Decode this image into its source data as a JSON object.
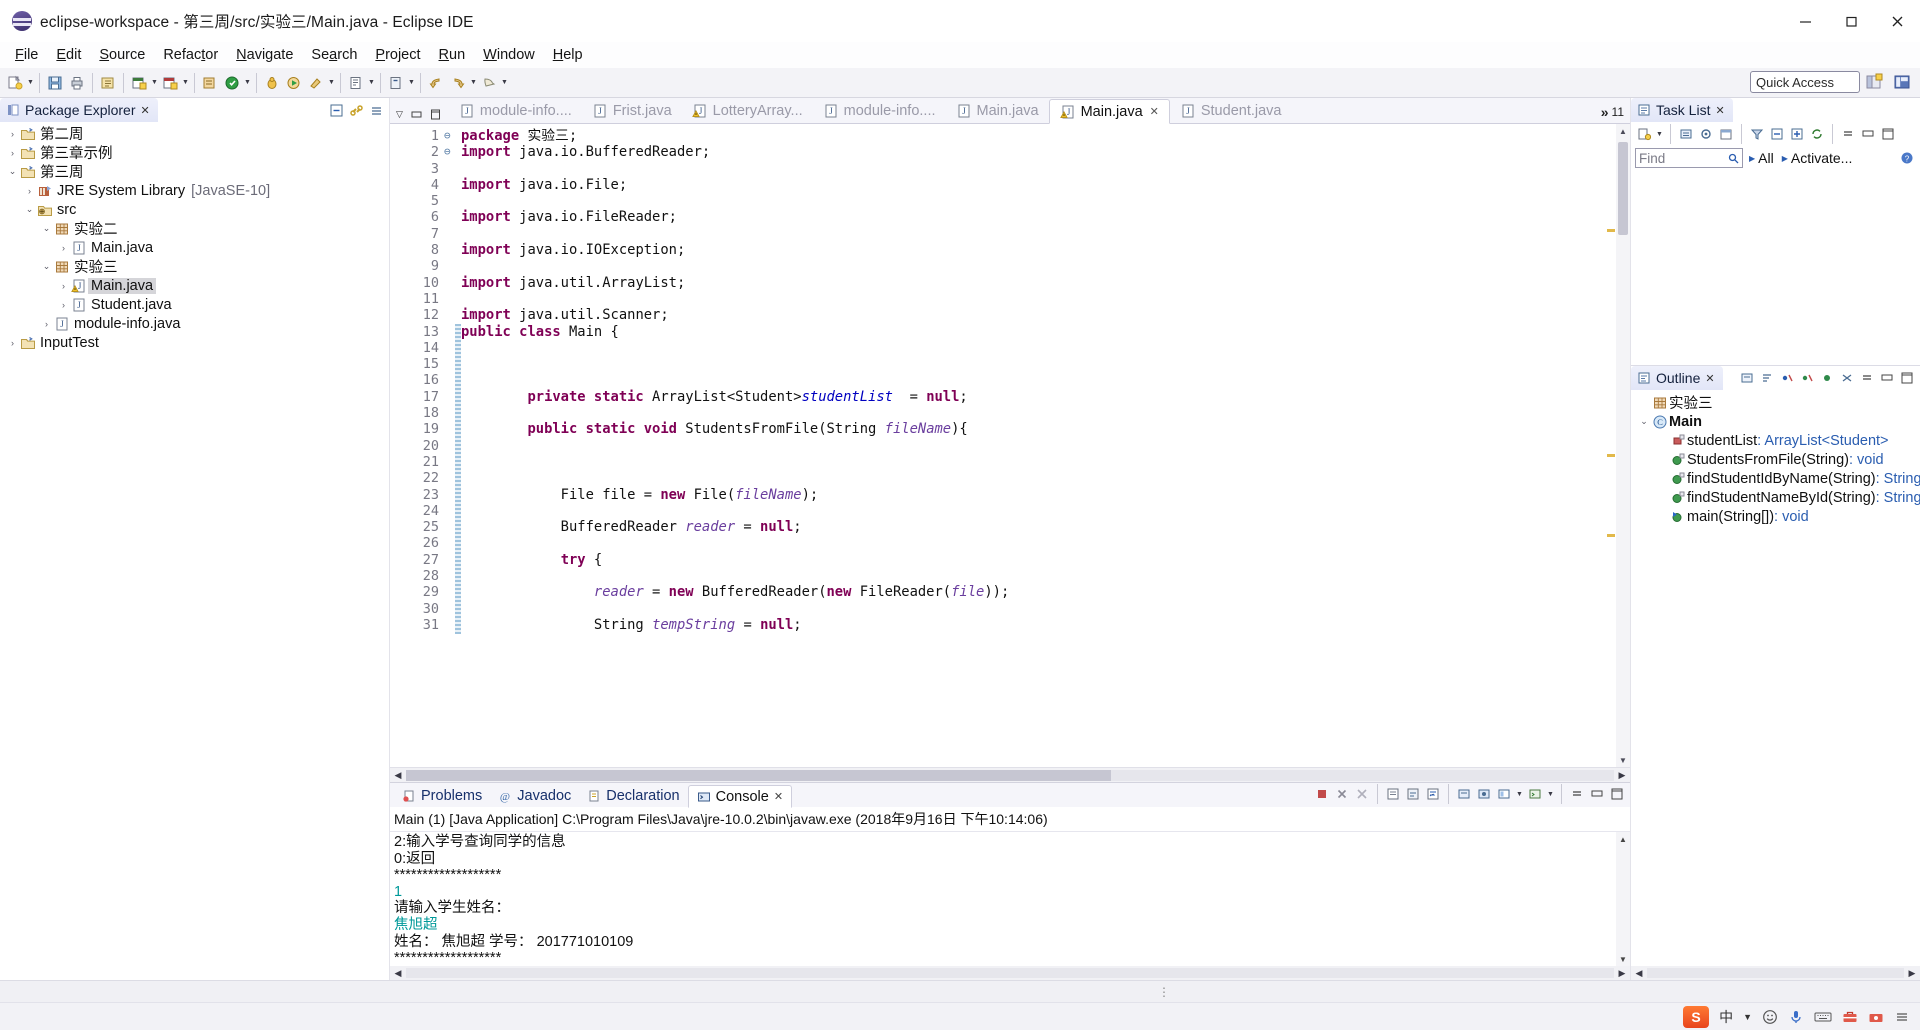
{
  "window": {
    "title": "eclipse-workspace - 第三周/src/实验三/Main.java - Eclipse IDE",
    "app_icon": "eclipse-icon",
    "minimize": "–",
    "maximize": "▢",
    "close": "✕"
  },
  "menu": [
    {
      "label": "File",
      "mnemonic": "F"
    },
    {
      "label": "Edit",
      "mnemonic": "E"
    },
    {
      "label": "Source",
      "mnemonic": "S"
    },
    {
      "label": "Refactor",
      "mnemonic": "t"
    },
    {
      "label": "Navigate",
      "mnemonic": "N"
    },
    {
      "label": "Search",
      "mnemonic": "a"
    },
    {
      "label": "Project",
      "mnemonic": "P"
    },
    {
      "label": "Run",
      "mnemonic": "R"
    },
    {
      "label": "Window",
      "mnemonic": "W"
    },
    {
      "label": "Help",
      "mnemonic": "H"
    }
  ],
  "toolbar": {
    "quick_access": "Quick Access",
    "buttons": [
      "new-wizard-icon",
      "save-icon",
      "print-icon",
      "build-all-icon",
      "new-java-project-icon",
      "new-package-icon",
      "new-class-icon",
      "debug-icon",
      "run-icon",
      "run-external-tools-icon",
      "coverage-icon",
      "new-java-element-icon",
      "open-type-icon",
      "search-icon",
      "next-annotation-icon",
      "previous-annotation-icon",
      "last-edit-location-icon",
      "back-icon",
      "forward-icon",
      "pin-editor-icon"
    ],
    "perspectives": [
      "open-perspective-icon",
      "java-perspective-icon"
    ]
  },
  "package_explorer": {
    "title": "Package Explorer",
    "close_glyph": "✕",
    "tools": [
      "collapse-all-icon",
      "link-with-editor-icon",
      "view-menu-icon"
    ],
    "tree": [
      {
        "indent": 0,
        "arrow": "collapsed",
        "icon": "java-project-icon",
        "label": "第二周",
        "selected": false,
        "dim": ""
      },
      {
        "indent": 0,
        "arrow": "collapsed",
        "icon": "java-project-icon",
        "label": "第三章示例",
        "selected": false,
        "dim": ""
      },
      {
        "indent": 0,
        "arrow": "expanded",
        "icon": "java-project-icon",
        "label": "第三周",
        "selected": false,
        "dim": ""
      },
      {
        "indent": 1,
        "arrow": "collapsed",
        "icon": "jre-library-icon",
        "label": "JRE System Library",
        "selected": false,
        "dim": "[JavaSE-10]"
      },
      {
        "indent": 1,
        "arrow": "expanded",
        "icon": "source-folder-icon",
        "label": "src",
        "selected": false,
        "dim": ""
      },
      {
        "indent": 2,
        "arrow": "expanded",
        "icon": "package-icon",
        "label": "实验二",
        "selected": false,
        "dim": ""
      },
      {
        "indent": 3,
        "arrow": "collapsed",
        "icon": "java-file-icon",
        "label": "Main.java",
        "selected": false,
        "dim": ""
      },
      {
        "indent": 2,
        "arrow": "expanded",
        "icon": "package-icon",
        "label": "实验三",
        "selected": false,
        "dim": ""
      },
      {
        "indent": 3,
        "arrow": "collapsed",
        "icon": "java-file-warning-icon",
        "label": "Main.java",
        "selected": true,
        "dim": ""
      },
      {
        "indent": 3,
        "arrow": "collapsed",
        "icon": "java-file-icon",
        "label": "Student.java",
        "selected": false,
        "dim": ""
      },
      {
        "indent": 2,
        "arrow": "collapsed",
        "icon": "java-file-icon",
        "label": "module-info.java",
        "selected": false,
        "dim": ""
      },
      {
        "indent": 0,
        "arrow": "collapsed",
        "icon": "java-project-icon",
        "label": "InputTest",
        "selected": false,
        "dim": ""
      }
    ]
  },
  "editor": {
    "tabs": [
      {
        "label": "module-info....",
        "icon": "java-file-icon",
        "active": false
      },
      {
        "label": "Frist.java",
        "icon": "java-file-icon",
        "active": false
      },
      {
        "label": "LotteryArray...",
        "icon": "java-file-warning-icon",
        "active": false
      },
      {
        "label": "module-info....",
        "icon": "java-file-icon",
        "active": false
      },
      {
        "label": "Main.java",
        "icon": "java-file-icon",
        "active": false
      },
      {
        "label": "Main.java",
        "icon": "java-file-warning-icon",
        "active": true
      },
      {
        "label": "Student.java",
        "icon": "java-file-icon",
        "active": false
      }
    ],
    "active_tab_close": "✕",
    "overflow_chevron": "»",
    "overflow_count": "11",
    "view_menu": "▽",
    "minimize": "▭",
    "maximize": "▤",
    "lines": [
      {
        "n": "1",
        "fold": "",
        "html": "<span class=\"kw\">package</span> 实验三;"
      },
      {
        "n": "2",
        "fold": "⊖",
        "html": "<span class=\"kw\">import</span> java.io.BufferedReader;"
      },
      {
        "n": "3",
        "fold": "",
        "html": ""
      },
      {
        "n": "4",
        "fold": "",
        "html": "<span class=\"kw\">import</span> java.io.File;"
      },
      {
        "n": "5",
        "fold": "",
        "html": ""
      },
      {
        "n": "6",
        "fold": "",
        "html": "<span class=\"kw\">import</span> java.io.FileReader;"
      },
      {
        "n": "7",
        "fold": "",
        "html": ""
      },
      {
        "n": "8",
        "fold": "",
        "html": "<span class=\"kw\">import</span> java.io.IOException;"
      },
      {
        "n": "9",
        "fold": "",
        "html": ""
      },
      {
        "n": "10",
        "fold": "",
        "html": "<span class=\"kw\">import</span> java.util.ArrayList;"
      },
      {
        "n": "11",
        "fold": "",
        "html": ""
      },
      {
        "n": "12",
        "fold": "",
        "html": "<span class=\"kw\">import</span> java.util.Scanner;"
      },
      {
        "n": "13",
        "fold": "",
        "html": "<span class=\"kw\">public class</span> Main {"
      },
      {
        "n": "14",
        "fold": "",
        "html": ""
      },
      {
        "n": "15",
        "fold": "",
        "html": ""
      },
      {
        "n": "16",
        "fold": "",
        "html": ""
      },
      {
        "n": "17",
        "fold": "",
        "html": "        <span class=\"kw\">private static</span> ArrayList&lt;Student&gt;<span class=\"fld\">studentList</span>  = <span class=\"kw\">null</span>;"
      },
      {
        "n": "18",
        "fold": "",
        "html": ""
      },
      {
        "n": "19",
        "fold": "⊖",
        "html": "        <span class=\"kw\">public static void</span> StudentsFromFile(String <span class=\"param\">fileName</span>){"
      },
      {
        "n": "20",
        "fold": "",
        "html": ""
      },
      {
        "n": "21",
        "fold": "",
        "html": ""
      },
      {
        "n": "22",
        "fold": "",
        "html": ""
      },
      {
        "n": "23",
        "fold": "",
        "html": "            File file = <span class=\"kw\">new</span> File(<span class=\"param\">fileName</span>);"
      },
      {
        "n": "24",
        "fold": "",
        "html": ""
      },
      {
        "n": "25",
        "fold": "",
        "html": "            BufferedReader <span class=\"param\">reader</span> = <span class=\"kw\">null</span>;"
      },
      {
        "n": "26",
        "fold": "",
        "html": ""
      },
      {
        "n": "27",
        "fold": "",
        "html": "            <span class=\"kw\">try</span> {"
      },
      {
        "n": "28",
        "fold": "",
        "html": ""
      },
      {
        "n": "29",
        "fold": "",
        "html": "                <span class=\"param\">reader</span> = <span class=\"kw\">new</span> BufferedReader(<span class=\"kw\">new</span> FileReader(<span class=\"param\">file</span>));"
      },
      {
        "n": "30",
        "fold": "",
        "html": ""
      },
      {
        "n": "31",
        "fold": "",
        "html": "                String <span class=\"param\">tempString</span> = <span class=\"kw\">null</span>;"
      }
    ]
  },
  "bottom_panel": {
    "tabs": [
      {
        "label": "Problems",
        "icon": "problems-icon",
        "active": false
      },
      {
        "label": "Javadoc",
        "icon": "javadoc-icon",
        "active": false
      },
      {
        "label": "Declaration",
        "icon": "declaration-icon",
        "active": false
      },
      {
        "label": "Console",
        "icon": "console-icon",
        "active": true
      }
    ],
    "close_glyph": "✕",
    "launch_info": "Main (1) [Java Application] C:\\Program Files\\Java\\jre-10.0.2\\bin\\javaw.exe (2018年9月16日 下午10:14:06)",
    "tools": [
      "terminate-icon",
      "remove-launch-icon",
      "remove-all-terminated-icon",
      "clear-console-icon",
      "scroll-lock-icon",
      "word-wrap-icon",
      "show-console-on-output-icon",
      "pin-console-icon",
      "display-selected-console-icon",
      "open-console-icon",
      "view-menu-icon",
      "minimize-icon",
      "maximize-icon"
    ],
    "output": [
      {
        "text": "2:输入学号查询同学的信息",
        "kind": "out"
      },
      {
        "text": "0:返回",
        "kind": "out"
      },
      {
        "text": "*******************",
        "kind": "out"
      },
      {
        "text": "1",
        "kind": "in"
      },
      {
        "text": "请输入学生姓名：",
        "kind": "out"
      },
      {
        "text": "焦旭超",
        "kind": "in"
      },
      {
        "text": "姓名： 焦旭超 学号： 201771010109",
        "kind": "out"
      },
      {
        "text": "*******************",
        "kind": "out"
      }
    ]
  },
  "task_list": {
    "title": "Task List",
    "close_glyph": "✕",
    "find_placeholder": "Find",
    "find_value": "",
    "all_label": "All",
    "activate_label": "Activate...",
    "tools": [
      "new-task-icon",
      "categorize-icon",
      "focus-icon",
      "schedule-icon",
      "filter-icon",
      "collapse-all-icon",
      "expand-all-icon",
      "synchronize-icon",
      "view-menu-icon",
      "minimize-icon",
      "maximize-icon",
      "help-icon"
    ]
  },
  "outline": {
    "title": "Outline",
    "close_glyph": "✕",
    "tools": [
      "focus-on-active-task-icon",
      "sort-icon",
      "hide-fields-icon",
      "hide-static-icon",
      "hide-non-public-icon",
      "hide-local-types-icon",
      "view-menu-icon",
      "minimize-icon",
      "maximize-icon"
    ],
    "items": [
      {
        "indent": 0,
        "arrow": "",
        "icon": "package-icon",
        "label": "实验三",
        "type": "",
        "bold": false
      },
      {
        "indent": 0,
        "arrow": "expanded",
        "icon": "class-icon",
        "label": "Main",
        "type": "",
        "bold": true
      },
      {
        "indent": 1,
        "arrow": "",
        "icon": "private-field-icon",
        "label": "studentList",
        "type": " : ArrayList<Student>",
        "bold": false
      },
      {
        "indent": 1,
        "arrow": "",
        "icon": "public-method-icon",
        "label": "StudentsFromFile(String)",
        "type": " : void",
        "bold": false
      },
      {
        "indent": 1,
        "arrow": "",
        "icon": "public-method-icon",
        "label": "findStudentIdByName(String)",
        "type": " : String",
        "bold": false
      },
      {
        "indent": 1,
        "arrow": "",
        "icon": "public-method-icon",
        "label": "findStudentNameById(String)",
        "type": " : String",
        "bold": false
      },
      {
        "indent": 1,
        "arrow": "",
        "icon": "main-method-icon",
        "label": "main(String[])",
        "type": " : void",
        "bold": false
      }
    ]
  },
  "tray": {
    "items": [
      "sogou-logo",
      "中",
      "chevron-down-icon",
      "smiley-icon",
      "mic-icon",
      "keyboard-icon",
      "toolbox-icon",
      "settings-icon",
      "menu-icon"
    ],
    "ime_label": "中"
  }
}
